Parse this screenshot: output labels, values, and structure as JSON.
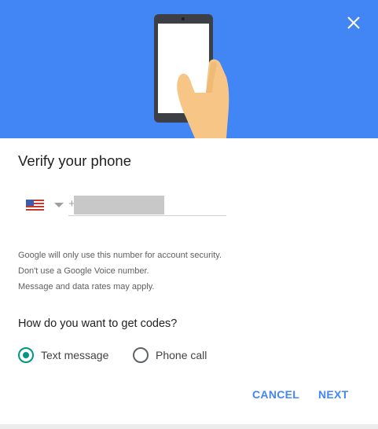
{
  "dialog": {
    "title": "Verify your phone",
    "close_icon": "close-icon",
    "hero_icon": "hand-holding-phone-illustration"
  },
  "phone": {
    "country_flag": "us-flag-icon",
    "prefix": "+",
    "value": "",
    "placeholder": ""
  },
  "info": {
    "line1": "Google will only use this number for account security.",
    "line2": "Don't use a Google Voice number.",
    "line3": "Message and data rates may apply."
  },
  "codes": {
    "question": "How do you want to get codes?",
    "options": [
      {
        "label": "Text message",
        "selected": true
      },
      {
        "label": "Phone call",
        "selected": false
      }
    ]
  },
  "actions": {
    "cancel_label": "CANCEL",
    "next_label": "NEXT"
  },
  "colors": {
    "hero_bg": "#4285f4",
    "accent": "#4285f4",
    "radio_selected": "#009688"
  }
}
